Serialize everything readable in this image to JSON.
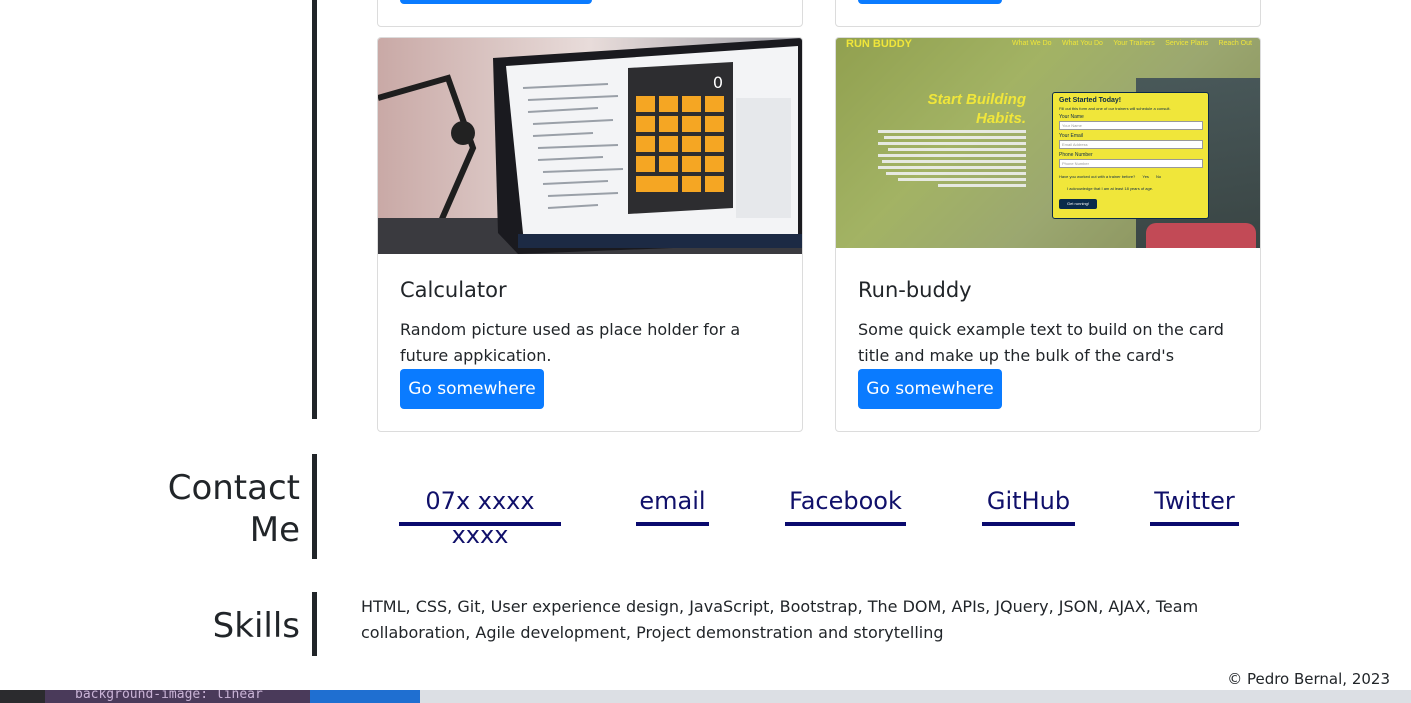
{
  "projects": [
    {
      "title": "Calculator",
      "text": "Random picture used as place holder for a future appkication.",
      "button": "Go somewhere",
      "calc_display": "0",
      "image": "calculator-screenshot"
    },
    {
      "title": "Run-buddy",
      "text": "Some quick example text to build on the card title and make up the bulk of the card's content.",
      "button": "Go somewhere",
      "image": "run-buddy-screenshot",
      "preview": {
        "brand": "RUN BUDDY",
        "nav": [
          "What We Do",
          "What You Do",
          "Your Trainers",
          "Service Plans",
          "Reach Out"
        ],
        "heading_line1": "Start Building",
        "heading_line2": "Habits.",
        "form_title": "Get Started Today!",
        "form_intro": "Fill out this form and one of our trainers will schedule a consult.",
        "name_label": "Your Name",
        "name_placeholder": "Your Name",
        "email_label": "Your Email",
        "email_placeholder": "Email Address",
        "phone_label": "Phone Number",
        "phone_placeholder": "Phone Number",
        "question": "Have you worked out with a trainer before?",
        "yes": "Yes",
        "no": "No",
        "ack": "I acknowledge that I am at least 18 years of age.",
        "submit": "Get running!"
      }
    }
  ],
  "contact": {
    "title_line1": "Contact",
    "title_line2": "Me",
    "links": [
      "07x xxxx xxxx",
      "email",
      "Facebook",
      "GitHub",
      "Twitter"
    ]
  },
  "skills": {
    "title": "Skills",
    "text": "HTML, CSS, Git, User experience design, JavaScript, Bootstrap, The DOM, APIs, JQuery, JSON, AJAX, Team collaboration, Agile development, Project demonstration and storytelling"
  },
  "footer": "© Pedro Bernal, 2023",
  "taskbar_text": "background-image: linear",
  "colors": {
    "accent": "#0a7bff",
    "link": "#10106a",
    "underline": "#0a0a6e",
    "calc_key": "#f5a623"
  }
}
